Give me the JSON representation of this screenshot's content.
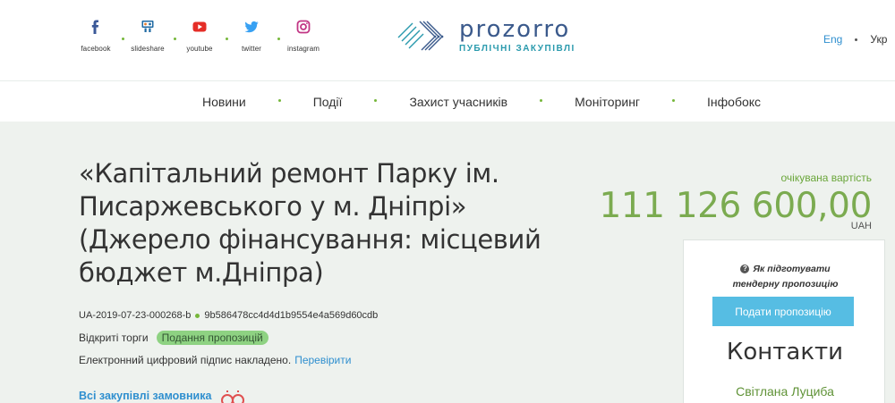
{
  "social": [
    {
      "label": "facebook",
      "icon": "facebook-icon"
    },
    {
      "label": "slideshare",
      "icon": "slideshare-icon"
    },
    {
      "label": "youtube",
      "icon": "youtube-icon"
    },
    {
      "label": "twitter",
      "icon": "twitter-icon"
    },
    {
      "label": "instagram",
      "icon": "instagram-icon"
    }
  ],
  "logo": {
    "name": "prozorro",
    "sub": "ПУБЛІЧНІ ЗАКУПІВЛІ"
  },
  "lang": {
    "en": "Eng",
    "uk": "Укр"
  },
  "nav": [
    "Новини",
    "Події",
    "Захист учасників",
    "Моніторинг",
    "Інфобокс"
  ],
  "tender": {
    "title": "«Капітальний ремонт Парку ім. Писаржевського у м. Дніпрі» (Джерело фінансування: місцевий бюджет м.Дніпра)",
    "id": "UA-2019-07-23-000268-b",
    "hash": "9b586478cc4d4d1b9554e4a569d60cdb",
    "procedure": "Відкриті торги",
    "status": "Подання пропозицій",
    "signature": "Електронний цифровий підпис накладено.",
    "verify": "Перевірити",
    "all_link": "Всі закупівлі замовника"
  },
  "expected": {
    "label": "очікувана вартість",
    "value": "111 126 600,00",
    "currency": "UAH"
  },
  "sidebar": {
    "howto": "Як підготувати тендерну пропозицію",
    "submit": "Подати пропозицію",
    "contacts": "Контакти",
    "person": "Світлана Луциба"
  },
  "colors": {
    "accent_green": "#7bab50",
    "link_blue": "#2f8fcf",
    "button_blue": "#56bde3"
  }
}
